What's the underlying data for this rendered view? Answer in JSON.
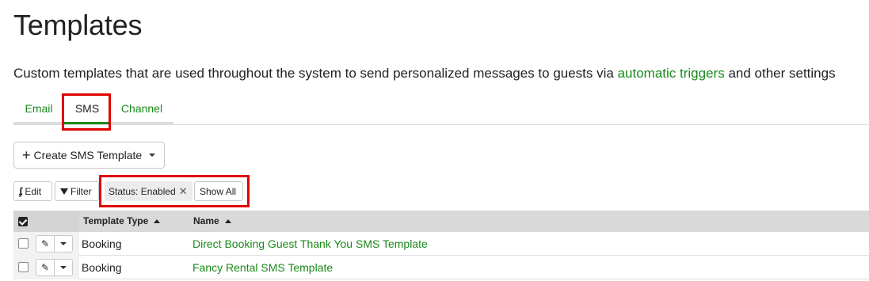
{
  "page": {
    "title": "Templates",
    "description_before": "Custom templates that are used throughout the system to send personalized messages to guests via ",
    "description_link": "automatic triggers",
    "description_after": " and other settings"
  },
  "tabs": [
    {
      "label": "Email",
      "active": false
    },
    {
      "label": "SMS",
      "active": true
    },
    {
      "label": "Channel",
      "active": false
    }
  ],
  "create_button": {
    "label": "Create SMS Template",
    "icon": "plus-icon"
  },
  "toolbar": {
    "edit_label": "Edit",
    "filter_label": "Filter",
    "status_chip": "Status: Enabled",
    "show_all_label": "Show All"
  },
  "table": {
    "columns": [
      "Template Type",
      "Name"
    ],
    "rows": [
      {
        "type": "Booking",
        "name": "Direct Booking Guest Thank You SMS Template"
      },
      {
        "type": "Booking",
        "name": "Fancy Rental SMS Template"
      }
    ]
  },
  "colors": {
    "link": "#1a8a1a",
    "highlight": "#e00000",
    "header_bg": "#d4d4d4"
  }
}
